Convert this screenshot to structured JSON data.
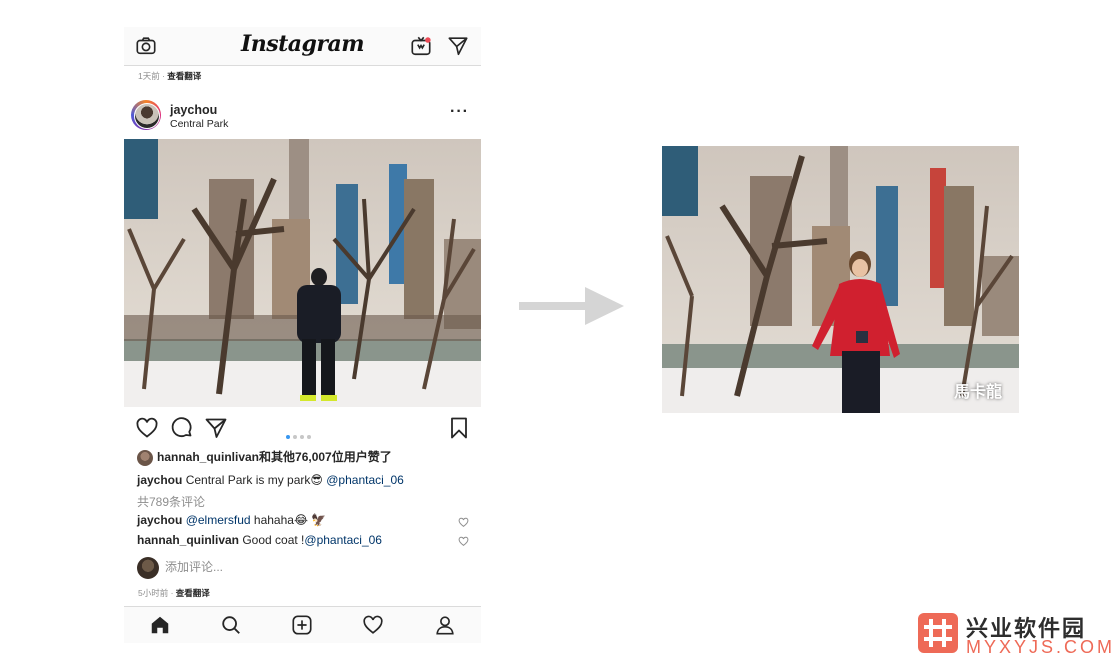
{
  "instagram": {
    "app_name": "Instagram",
    "prev_post_time": "1天前",
    "translate_label": "查看翻译",
    "post": {
      "username": "jaychou",
      "location": "Central Park",
      "more_label": "···",
      "carousel": {
        "count": 4,
        "active": 1
      },
      "liked_by_user": "hannah_quinlivan",
      "liked_by_rest": "和其他76,007位用户赞了",
      "caption_user": "jaychou",
      "caption_text": "Central Park is my park😎 ",
      "caption_mention": "@phantaci_06",
      "view_comments": "共789条评论",
      "comments": [
        {
          "user": "jaychou",
          "mention": "@elmersfud",
          "text": " hahaha😂 🦅"
        },
        {
          "user": "hannah_quinlivan",
          "text": " Good coat !",
          "mention": "@phantaci_06"
        }
      ],
      "add_comment_placeholder": "添加评论...",
      "post_time": "5小时前"
    },
    "top_icons": [
      "camera-icon",
      "igtv-icon",
      "direct-message-icon"
    ],
    "action_icons": [
      "heart-icon",
      "comment-icon",
      "share-icon",
      "bookmark-icon"
    ],
    "nav_icons": [
      "home-icon",
      "search-icon",
      "add-post-icon",
      "activity-heart-icon",
      "profile-icon"
    ]
  },
  "right_image": {
    "watermark": "馬卡龍"
  },
  "site": {
    "name": "兴业软件园",
    "url": "MYXYJS.COM"
  },
  "colors": {
    "accent_blue": "#3897f0",
    "mention": "#003569",
    "site_red": "#ee6a57"
  }
}
